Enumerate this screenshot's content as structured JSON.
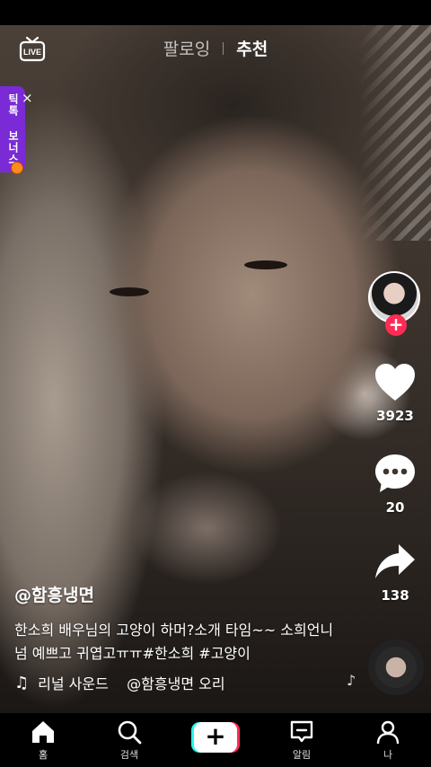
{
  "top_tabs": {
    "following": "팔로잉",
    "for_you": "추천"
  },
  "live_icon": "live-tv-icon",
  "bonus_banner": {
    "label": "틱톡 보너스",
    "close": "×"
  },
  "creator": {
    "avatar": "creator-avatar",
    "follow_symbol": "+"
  },
  "actions": {
    "likes": "3923",
    "comments": "20",
    "shares": "138"
  },
  "caption": {
    "author": "@함흥냉면",
    "text": "한소희 배우님의 고양이 하머?소개 타임~~ 소희언니 넘 예쁘고 귀엽고ㅠㅠ#한소희 #고양이"
  },
  "music": {
    "text": "리널 사운드    @함흥냉면 오리"
  },
  "nav": {
    "home": "홈",
    "search": "검색",
    "create": "+",
    "inbox": "알림",
    "profile": "나"
  },
  "colors": {
    "accent_red": "#fe2c55",
    "accent_cyan": "#25f4ee",
    "bonus_purple": "#7a2bd6"
  }
}
